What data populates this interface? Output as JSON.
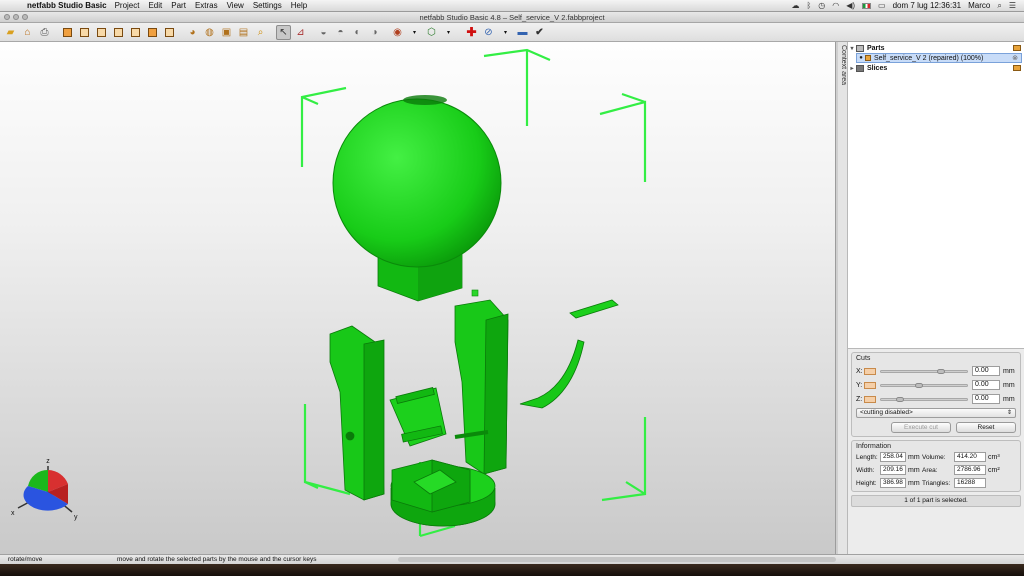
{
  "menubar": {
    "app_name": "netfabb Studio Basic",
    "menus": [
      "Project",
      "Edit",
      "Part",
      "Extras",
      "View",
      "Settings",
      "Help"
    ],
    "datetime": "dom 7 lug  12:36:31",
    "user": "Marco"
  },
  "window": {
    "title": "netfabb Studio Basic 4.8 – Self_service_V 2.fabbproject"
  },
  "sidebar": {
    "context_tab_label": "Context area",
    "tree": {
      "parts_label": "Parts",
      "part_item": "Self_service_V 2 (repaired) (100%)",
      "slices_label": "Slices"
    }
  },
  "cuts": {
    "title": "Cuts",
    "axes": [
      {
        "label": "X:",
        "value": "0.00",
        "unit": "mm"
      },
      {
        "label": "Y:",
        "value": "0.00",
        "unit": "mm"
      },
      {
        "label": "Z:",
        "value": "0.00",
        "unit": "mm"
      }
    ],
    "mode_option": "<cutting disabled>",
    "execute_label": "Execute cut",
    "reset_label": "Reset"
  },
  "information": {
    "title": "Information",
    "length_label": "Length:",
    "length_value": "258.04",
    "length_unit": "mm",
    "width_label": "Width:",
    "width_value": "209.16",
    "width_unit": "mm",
    "height_label": "Height:",
    "height_value": "386.98",
    "height_unit": "mm",
    "volume_label": "Volume:",
    "volume_value": "414.20",
    "volume_unit": "cm³",
    "area_label": "Area:",
    "area_value": "2786.96",
    "area_unit": "cm²",
    "triangles_label": "Triangles:",
    "triangles_value": "16288"
  },
  "selection_status": "1 of 1 part is selected.",
  "statusbar": {
    "mode": "rotate/move",
    "hint": "move and rotate the selected parts by the mouse and the cursor keys"
  },
  "axis_gizmo": {
    "x": "x",
    "y": "y",
    "z": "z"
  },
  "colors": {
    "model": "#19d419",
    "model_dark": "#0a8f0a",
    "bbox": "#33ee44"
  }
}
